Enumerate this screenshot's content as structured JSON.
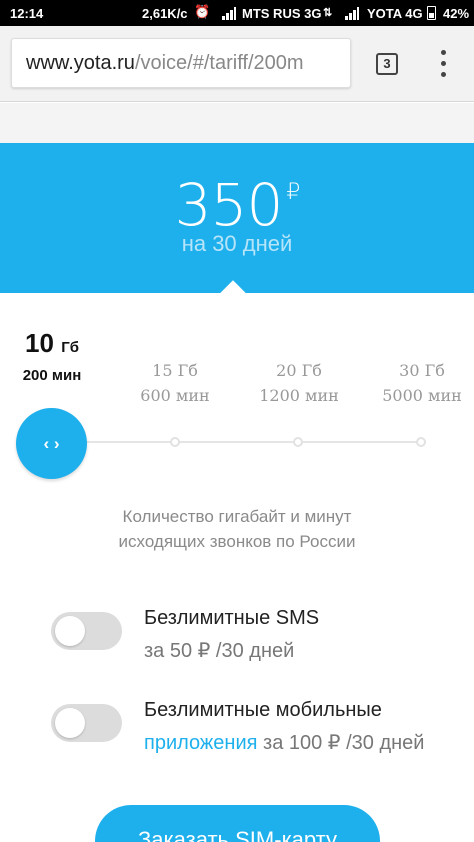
{
  "status_bar": {
    "time": "12:14",
    "speed": "2,61K/c",
    "carrier1": "MTS RUS 3G",
    "carrier2": "YOTA 4G",
    "battery": "42%"
  },
  "browser": {
    "url_host": "www.yota.ru",
    "url_path": "/voice/#/tariff/200m",
    "tab_count": "3"
  },
  "tariff": {
    "price": "350",
    "currency": "₽",
    "period": "на 30 дней"
  },
  "options": [
    {
      "gb": "10",
      "gb_unit": "Гб",
      "minutes": "200 мин"
    },
    {
      "gb": "15 Гб",
      "minutes": "600 мин"
    },
    {
      "gb": "20 Гб",
      "minutes": "1200 мин"
    },
    {
      "gb": "30 Гб",
      "minutes": "5000 мин"
    }
  ],
  "slider": {
    "handle_label": "‹ ›",
    "selected_index": 0
  },
  "caption": {
    "line1": "Количество гигабайт и минут",
    "line2": "исходящих звонков по России"
  },
  "addons": [
    {
      "title": "Безлимитные SMS",
      "price": "за 50 ₽ /30 дней",
      "enabled": false
    },
    {
      "title": "Безлимитные мобильные",
      "link": "приложения",
      "price": " за 100 ₽ /30 дней",
      "enabled": false
    }
  ],
  "order_button": "Заказать SIM-карту",
  "colors": {
    "accent": "#1eb0ec",
    "status_bar": "#000000"
  }
}
